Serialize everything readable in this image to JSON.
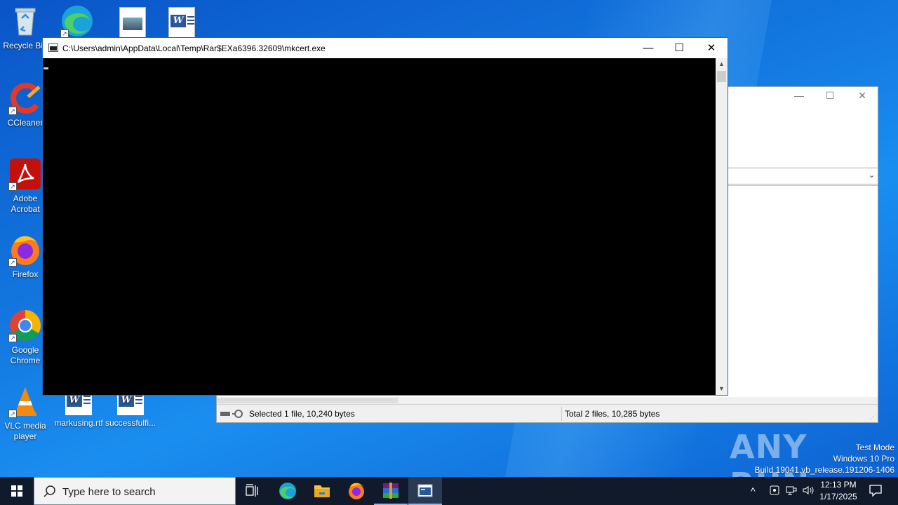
{
  "desktop": {
    "icons": [
      {
        "label": "Recycle Bin"
      },
      {
        "label": "CCleaner"
      },
      {
        "label": "Adobe Acrobat"
      },
      {
        "label": "Firefox"
      },
      {
        "label": "Google Chrome"
      },
      {
        "label": "VLC media player"
      },
      {
        "label": "markusing.rtf"
      },
      {
        "label": "successfulfi..."
      }
    ]
  },
  "console_window": {
    "title": "C:\\Users\\admin\\AppData\\Local\\Temp\\Rar$EXa6396.32609\\mkcert.exe",
    "minimize": "—",
    "maximize": "☐",
    "close": "✕"
  },
  "winrar_window": {
    "status_selected": "Selected 1 file, 10,240 bytes",
    "status_total": "Total 2 files, 10,285 bytes",
    "minimize": "—",
    "maximize": "☐",
    "close": "✕"
  },
  "watermark": {
    "text": "ANY RUN",
    "test_mode": "Test Mode",
    "edition": "Windows 10 Pro",
    "build": "Build 19041.vb_release.191206-1406"
  },
  "taskbar": {
    "search_placeholder": "Type here to search",
    "time": "12:13 PM",
    "date": "1/17/2025"
  },
  "colors": {
    "desktop_blue": "#0a6fd8",
    "taskbar": "#101a2b",
    "console_bg": "#000000",
    "accent": "#1b6ac9"
  }
}
